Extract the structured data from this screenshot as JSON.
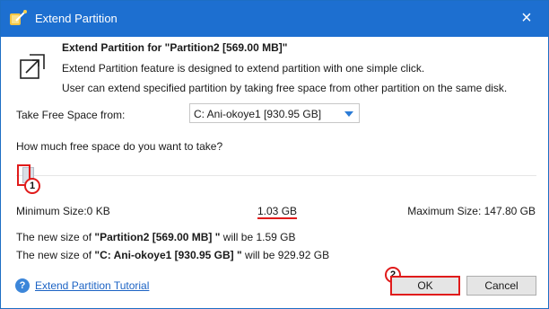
{
  "window": {
    "title": "Extend Partition"
  },
  "header": {
    "heading": "Extend Partition for \"Partition2 [569.00 MB]\"",
    "desc_line1": "Extend Partition feature is designed to extend partition with one simple click.",
    "desc_line2": "User can extend specified partition by taking free space from other partition on the same disk."
  },
  "source": {
    "label": "Take Free Space from:",
    "selected": "C: Ani-okoye1 [930.95 GB]"
  },
  "slider": {
    "question": "How much free space do you want to take?",
    "min_label": "Minimum Size:0 KB",
    "current_label": "1.03 GB",
    "max_label": "Maximum Size: 147.80 GB",
    "level_fraction": 0.007
  },
  "results": {
    "line1_prefix": "The new size of ",
    "line1_name": "\"Partition2 [569.00 MB] \"",
    "line1_suffix": " will be 1.59 GB",
    "line2_prefix": "The new size of ",
    "line2_name": "\"C: Ani-okoye1 [930.95 GB] \"",
    "line2_suffix": " will be 929.92 GB"
  },
  "footer": {
    "tutorial_link": "Extend Partition Tutorial",
    "ok_label": "OK",
    "cancel_label": "Cancel",
    "help_glyph": "?"
  },
  "annotations": {
    "badge1": "1",
    "badge2": "2"
  },
  "colors": {
    "titlebar": "#1d6fd0",
    "highlight": "#e01b1b",
    "link": "#1c63c4"
  },
  "icons": [
    "app-wand-icon",
    "close-icon",
    "extend-partition-icon",
    "dropdown-arrow-icon",
    "help-icon"
  ]
}
